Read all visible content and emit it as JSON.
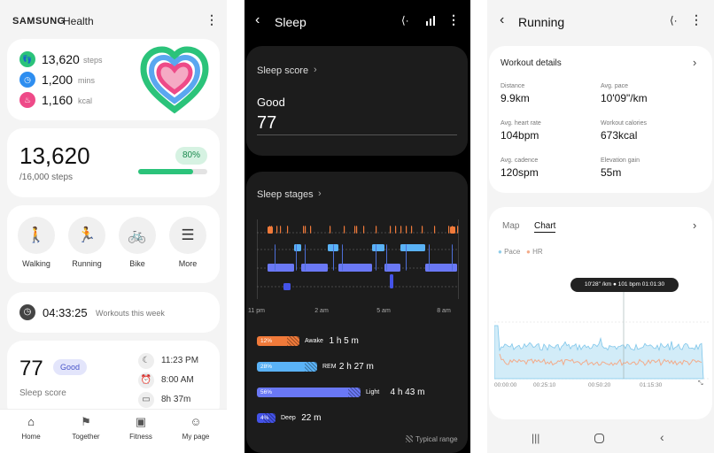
{
  "home": {
    "logo": "SAMSUNG",
    "app_name": "Health",
    "summary": [
      {
        "value": "13,620",
        "unit": "steps",
        "color": "#2bc37a",
        "icon": "footprints-icon"
      },
      {
        "value": "1,200",
        "unit": "mins",
        "color": "#2e8ef0",
        "icon": "clock-icon"
      },
      {
        "value": "1,160",
        "unit": "kcal",
        "color": "#ee4a88",
        "icon": "flame-icon"
      }
    ],
    "steps": {
      "value": "13,620",
      "goal": "/16,000 steps",
      "percent_label": "80%",
      "progress": 0.8
    },
    "activities": [
      {
        "label": "Walking",
        "icon": "walking-icon"
      },
      {
        "label": "Running",
        "icon": "running-icon"
      },
      {
        "label": "Bike",
        "icon": "bike-icon"
      },
      {
        "label": "More",
        "icon": "list-icon"
      }
    ],
    "workouts": {
      "time": "04:33:25",
      "label": "Workouts this week"
    },
    "sleep": {
      "score": "77",
      "badge": "Good",
      "label": "Sleep score",
      "bedtime": "11:23 PM",
      "wake": "8:00 AM",
      "duration": "8h 37m"
    },
    "nav": [
      "Home",
      "Together",
      "Fitness",
      "My page"
    ]
  },
  "sleep": {
    "title": "Sleep",
    "score_label": "Sleep score",
    "rating": "Good",
    "score": "77",
    "stages_label": "Sleep stages",
    "axis": [
      "11 pm",
      "2 am",
      "5 am",
      "8 am"
    ],
    "stages": [
      {
        "pct": "12%",
        "name": "Awake",
        "dur": "1 h 5 m",
        "color": "#f07a3a",
        "fill": 0.32
      },
      {
        "pct": "28%",
        "name": "REM",
        "dur": "2 h 27 m",
        "color": "#5ab2f6",
        "fill": 0.45
      },
      {
        "pct": "56%",
        "name": "Light",
        "dur": "4 h 43 m",
        "color": "#6a78f5",
        "fill": 0.78
      },
      {
        "pct": "4%",
        "name": "Deep",
        "dur": "22 m",
        "color": "#4453e8",
        "fill": 0.14
      }
    ],
    "legend": "Typical range"
  },
  "run": {
    "title": "Running",
    "details_label": "Workout details",
    "stats": [
      {
        "label": "Distance",
        "value": "9.9",
        "unit": "km"
      },
      {
        "label": "Avg. pace",
        "value": "10'09\"",
        "unit": "/km"
      },
      {
        "label": "Avg. heart rate",
        "value": "104",
        "unit": "bpm"
      },
      {
        "label": "Workout calories",
        "value": "673",
        "unit": "kcal"
      },
      {
        "label": "Avg. cadence",
        "value": "120",
        "unit": "spm"
      },
      {
        "label": "Elevation gain",
        "value": "55",
        "unit": "m"
      }
    ],
    "tabs": [
      "Map",
      "Chart"
    ],
    "legend": [
      "Pace",
      "HR"
    ],
    "tooltip": "10'28\" /km  ● 101 bpm  01:01:30",
    "axis": [
      "00:00:00",
      "00:25:10",
      "00:50:20",
      "01:15:30"
    ],
    "colors": {
      "pace": "#9fd8f3",
      "hr": "#f3ab8a"
    }
  }
}
